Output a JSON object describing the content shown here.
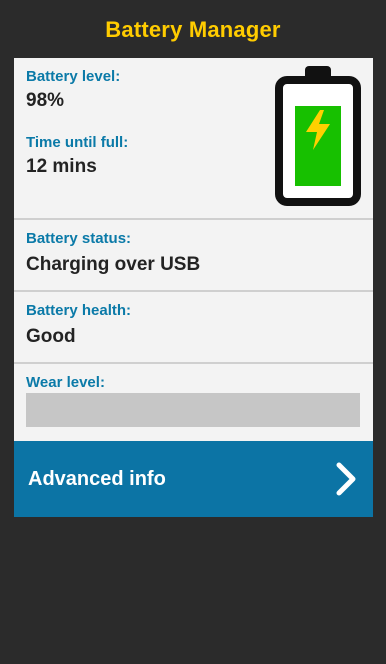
{
  "app": {
    "title": "Battery Manager"
  },
  "battery": {
    "level_label": "Battery level:",
    "level_value": "98%",
    "time_label": "Time until full:",
    "time_value": "12 mins",
    "status_label": "Battery status:",
    "status_value": "Charging over USB",
    "health_label": "Battery health:",
    "health_value": "Good",
    "wear_label": "Wear level:",
    "wear_value": ""
  },
  "advanced": {
    "label": "Advanced info",
    "icon": "chevron-right-icon"
  },
  "colors": {
    "background": "#2b2b2b",
    "title": "#FFCC00",
    "label": "#0b7aa8",
    "value": "#232323",
    "card": "#f3f3f3",
    "battery_fill": "#17c000",
    "bolt": "#ffd000",
    "advanced_bg": "#0c74a5"
  },
  "icons": {
    "battery": "battery-charging-icon",
    "bolt": "lightning-bolt-icon"
  }
}
